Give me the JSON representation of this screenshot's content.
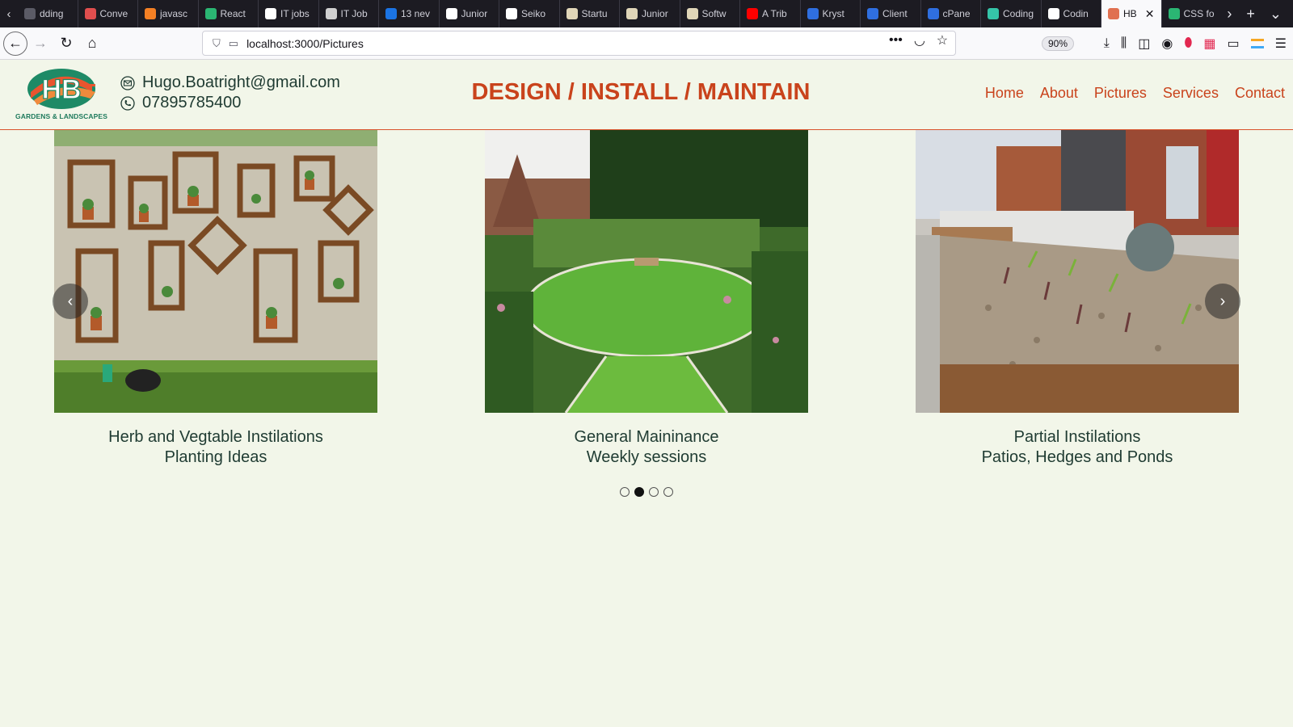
{
  "browser": {
    "tabs": [
      {
        "title": "dding",
        "icon": "generic-page-icon",
        "color": "#5b5b66"
      },
      {
        "title": "Conve",
        "icon": "red-circle-icon",
        "color": "#e04e4e"
      },
      {
        "title": "javasc",
        "icon": "stackoverflow-icon",
        "color": "#f48024"
      },
      {
        "title": "React",
        "icon": "w-logo-icon",
        "color": "#2bb673"
      },
      {
        "title": "IT jobs",
        "icon": "itjobs-icon",
        "color": "#ffffff"
      },
      {
        "title": "IT Job",
        "icon": "itjob-icon",
        "color": "#d0d0d0"
      },
      {
        "title": "13 nev",
        "icon": "js-icon",
        "color": "#1b74e4"
      },
      {
        "title": "Junior",
        "icon": "d-logo-icon",
        "color": "#ffffff"
      },
      {
        "title": "Seiko",
        "icon": "p-logo-icon",
        "color": "#ffffff"
      },
      {
        "title": "Startu",
        "icon": "w-logo-icon",
        "color": "#e0d6b8"
      },
      {
        "title": "Junior",
        "icon": "w-logo-icon",
        "color": "#e0d6b8"
      },
      {
        "title": "Softw",
        "icon": "w-logo-icon",
        "color": "#e0d6b8"
      },
      {
        "title": "A Trib",
        "icon": "youtube-icon",
        "color": "#ff0000"
      },
      {
        "title": "Kryst",
        "icon": "shield-icon",
        "color": "#2f6fe0"
      },
      {
        "title": "Client",
        "icon": "shield-icon",
        "color": "#2f6fe0"
      },
      {
        "title": "cPane",
        "icon": "shield-icon",
        "color": "#2f6fe0"
      },
      {
        "title": "Coding",
        "icon": "codingame-icon",
        "color": "#35c4a8"
      },
      {
        "title": "Codin",
        "icon": "codepen-icon",
        "color": "#ffffff"
      },
      {
        "title": "HB",
        "icon": "hb-icon",
        "color": "#e07050",
        "active": true
      },
      {
        "title": "CSS fo",
        "icon": "w-logo-icon",
        "color": "#2bb673"
      }
    ],
    "url": "localhost:3000/Pictures",
    "zoom": "90%"
  },
  "header": {
    "logo_letters": "HB",
    "logo_text": "GARDENS & LANDSCAPES",
    "email": "Hugo.Boatright@gmail.com",
    "phone": "07895785400",
    "tagline": "DESIGN / INSTALL / MAINTAIN",
    "nav": [
      "Home",
      "About",
      "Pictures",
      "Services",
      "Contact"
    ],
    "accent": "#c9431c",
    "brand_green": "#1e7a5c"
  },
  "carousel": {
    "slides": [
      {
        "line1": "Herb and Vegtable Instilations",
        "line2": "Planting Ideas"
      },
      {
        "line1": "General Maininance",
        "line2": "Weekly sessions"
      },
      {
        "line1": "Partial Instilations",
        "line2": "Patios, Hedges and Ponds"
      }
    ],
    "dots": 4,
    "active_dot": 2,
    "prev_glyph": "‹",
    "next_glyph": "›"
  }
}
